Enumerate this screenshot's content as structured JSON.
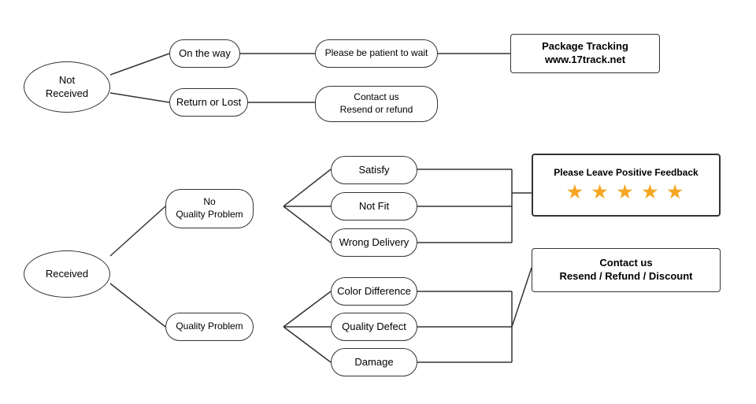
{
  "nodes": {
    "not_received": {
      "label": "Not\nReceived"
    },
    "on_the_way": {
      "label": "On the way"
    },
    "patient": {
      "label": "Please be patient to wait"
    },
    "package_tracking": {
      "label": "Package Tracking\nwww.17track.net"
    },
    "return_or_lost": {
      "label": "Return or Lost"
    },
    "contact_resend": {
      "label": "Contact us\nResend or refund"
    },
    "received": {
      "label": "Received"
    },
    "no_quality": {
      "label": "No\nQuality Problem"
    },
    "satisfy": {
      "label": "Satisfy"
    },
    "not_fit": {
      "label": "Not Fit"
    },
    "wrong_delivery": {
      "label": "Wrong Delivery"
    },
    "quality_problem": {
      "label": "Quality Problem"
    },
    "color_diff": {
      "label": "Color Difference"
    },
    "quality_defect": {
      "label": "Quality Defect"
    },
    "damage": {
      "label": "Damage"
    },
    "feedback": {
      "label": "Please Leave Positive Feedback"
    },
    "stars": {
      "label": "★ ★ ★ ★ ★"
    },
    "contact_resend2": {
      "label": "Contact us\nResend / Refund / Discount"
    }
  }
}
